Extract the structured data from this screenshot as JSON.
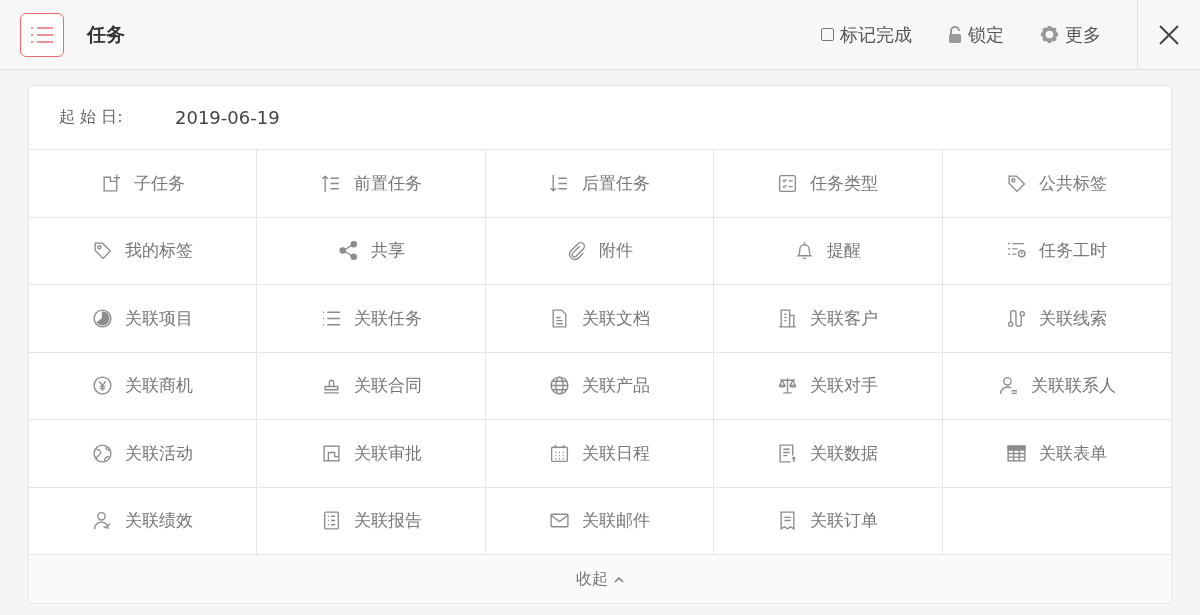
{
  "header": {
    "title": "任务",
    "actions": [
      {
        "kind": "checkbox",
        "label": "标记完成",
        "checked": false
      },
      {
        "kind": "lock",
        "label": "锁定"
      },
      {
        "kind": "more",
        "label": "更多"
      }
    ]
  },
  "start_date": {
    "label": "起 始 日:",
    "value": "2019-06-19"
  },
  "actions": [
    {
      "label": "子任务"
    },
    {
      "label": "前置任务"
    },
    {
      "label": "后置任务"
    },
    {
      "label": "任务类型"
    },
    {
      "label": "公共标签"
    },
    {
      "label": "我的标签"
    },
    {
      "label": "共享"
    },
    {
      "label": "附件"
    },
    {
      "label": "提醒"
    },
    {
      "label": "任务工时"
    },
    {
      "label": "关联项目"
    },
    {
      "label": "关联任务"
    },
    {
      "label": "关联文档"
    },
    {
      "label": "关联客户"
    },
    {
      "label": "关联线索"
    },
    {
      "label": "关联商机"
    },
    {
      "label": "关联合同"
    },
    {
      "label": "关联产品"
    },
    {
      "label": "关联对手"
    },
    {
      "label": "关联联系人"
    },
    {
      "label": "关联活动"
    },
    {
      "label": "关联审批"
    },
    {
      "label": "关联日程"
    },
    {
      "label": "关联数据"
    },
    {
      "label": "关联表单"
    },
    {
      "label": "关联绩效"
    },
    {
      "label": "关联报告"
    },
    {
      "label": "关联邮件"
    },
    {
      "label": "关联订单"
    }
  ],
  "collapse": {
    "label": "收起"
  }
}
